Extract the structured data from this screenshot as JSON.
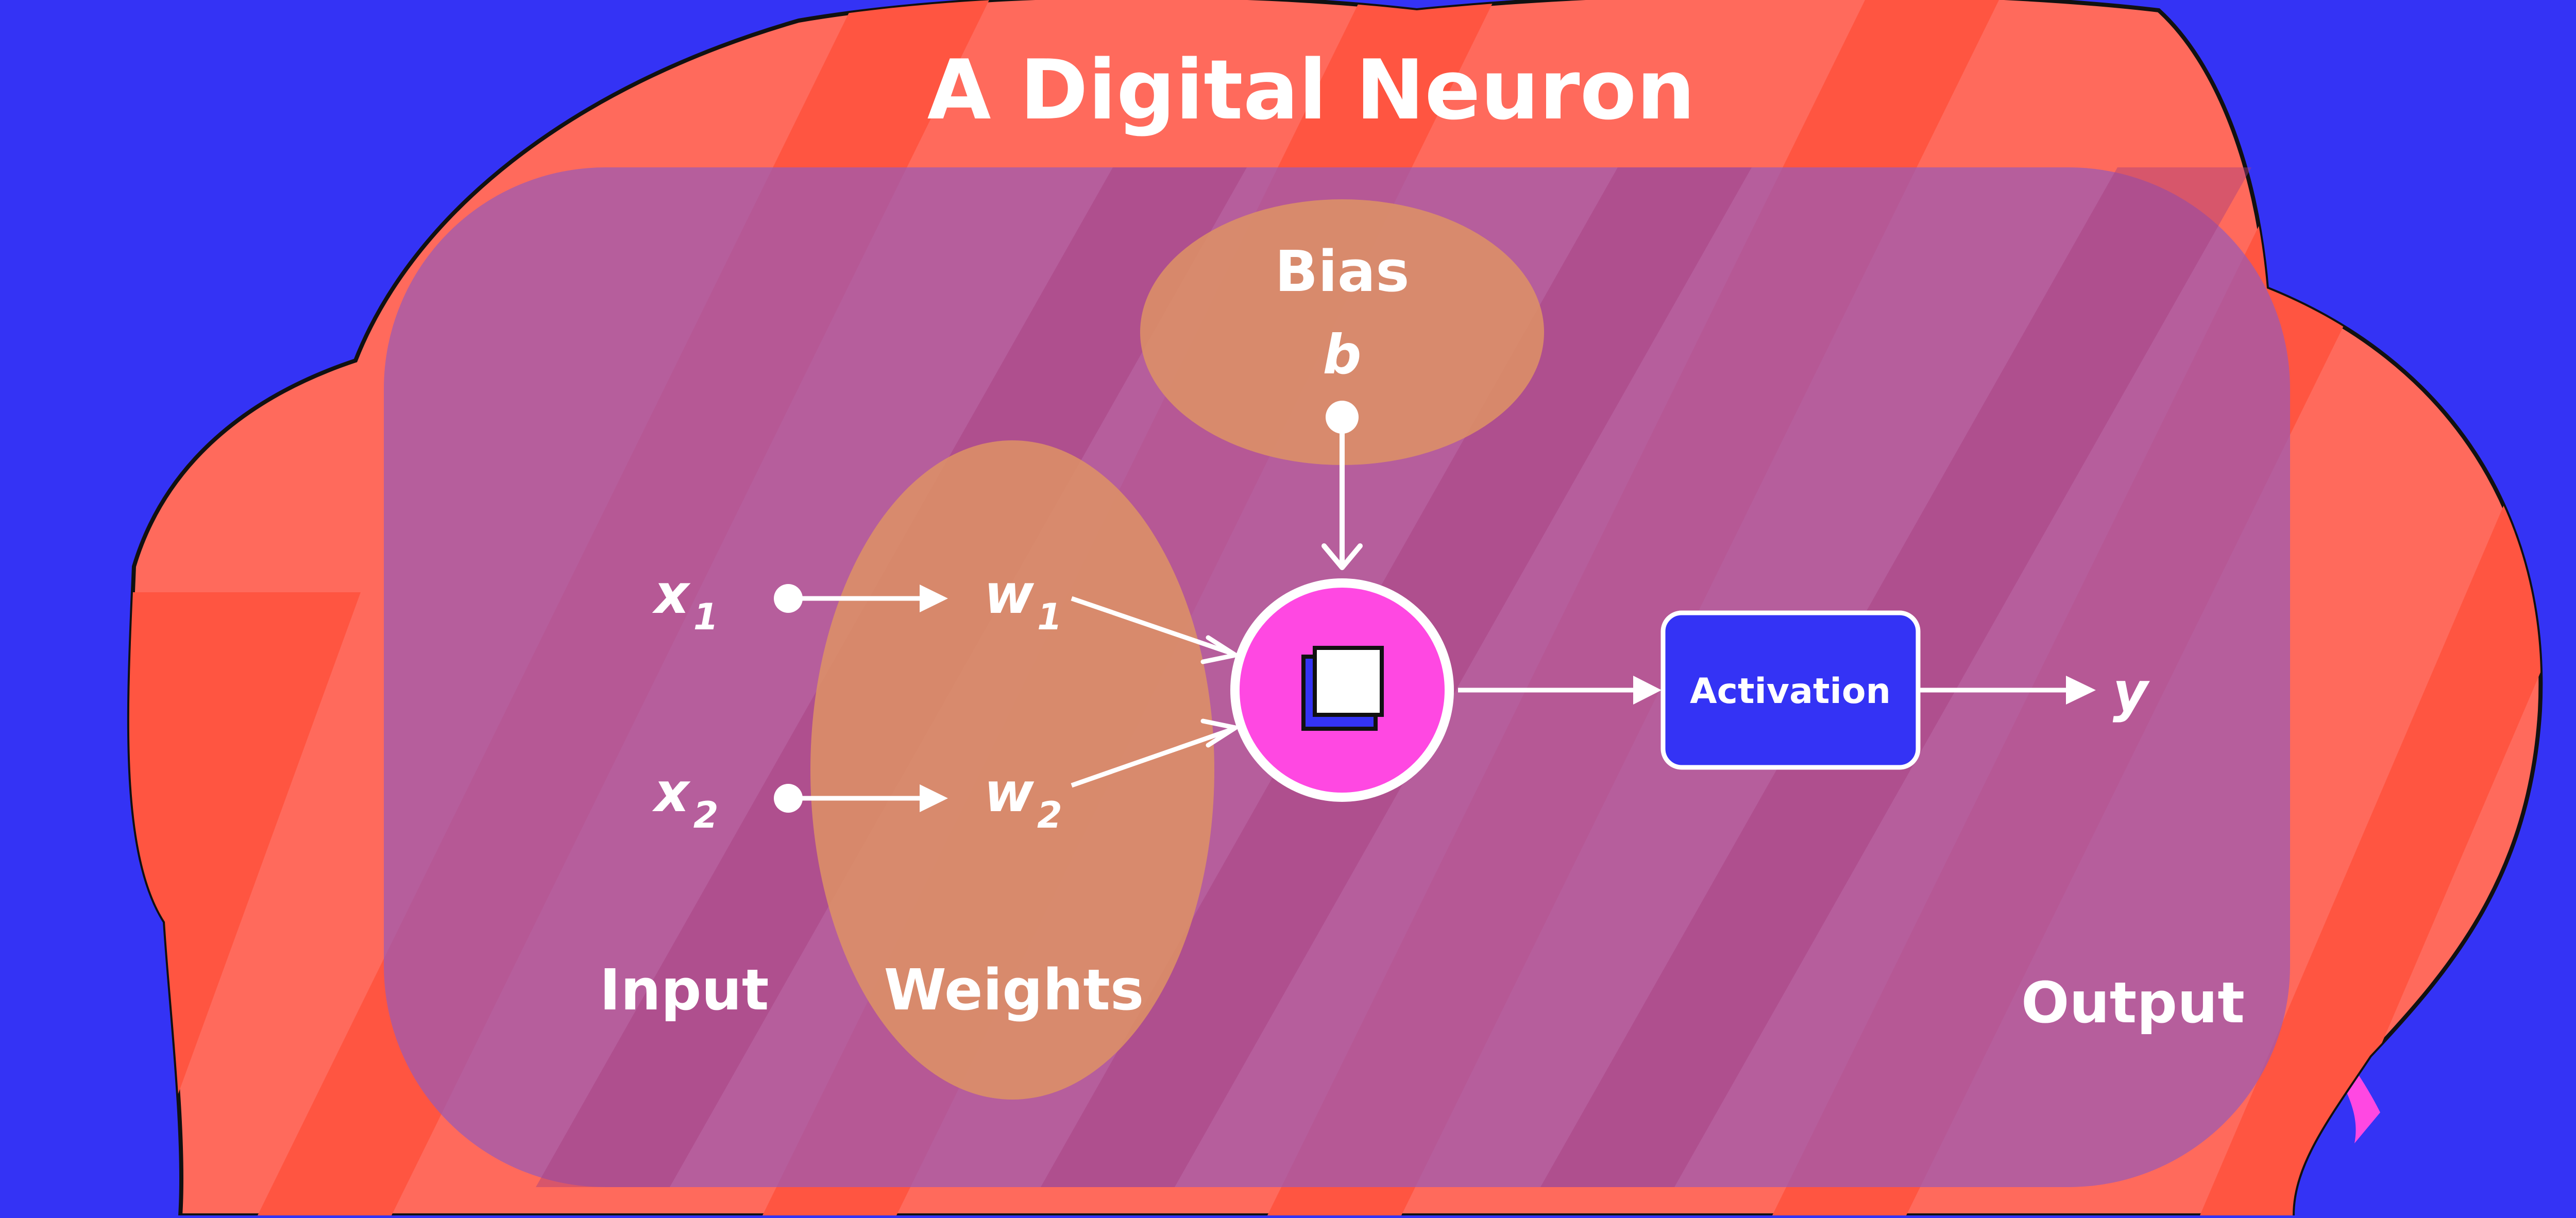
{
  "title": "A Digital Neuron",
  "inputs": [
    {
      "name": "x",
      "index": "1"
    },
    {
      "name": "x",
      "index": "2"
    }
  ],
  "weights": [
    {
      "name": "w",
      "index": "1"
    },
    {
      "name": "w",
      "index": "2"
    }
  ],
  "bias": {
    "label": "Bias",
    "symbol": "b"
  },
  "activation": {
    "label": "Activation"
  },
  "output": {
    "symbol": "y"
  },
  "group_labels": {
    "input": "Input",
    "weights": "Weights",
    "output": "Output"
  },
  "colors": {
    "background": "#3433f5",
    "cloud": "#ff6a5c",
    "cloud_dark": "#ff5541",
    "panel": "#b7609a",
    "ellipse": "#dd9166",
    "neuron_fill": "#ff48e2",
    "activation_fill": "#3433f5",
    "line": "#ffffff"
  },
  "icons": {
    "neuron": "square-cube-icon",
    "arrow": "arrow-right-icon"
  }
}
